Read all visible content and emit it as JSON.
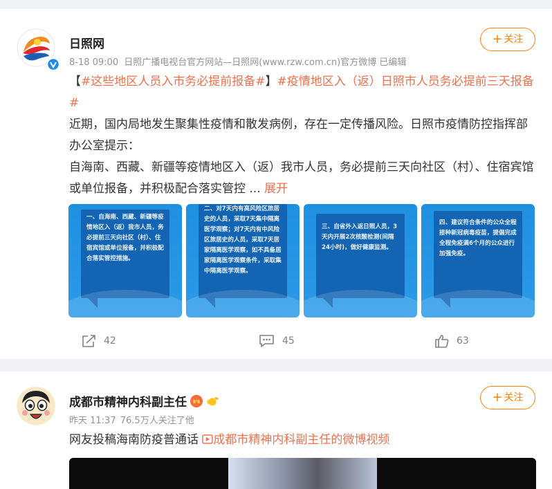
{
  "colors": {
    "accent": "#ff8200",
    "tag": "#eb7350",
    "tile_bg": "#1f8fe0",
    "tile_box": "#1464b4"
  },
  "post1": {
    "author": "日照网",
    "time": "8-18 09:00",
    "source": "日照广播电视台官方网站—日照网(www.rzw.com.cn)官方微博 已编辑",
    "follow_label": "关注",
    "tag_open": "【",
    "tag1": "#这些地区人员入市务必提前报备#",
    "tag_close": "】",
    "tag2": "#疫情地区入（返）日照市人员务必提前三天报备#",
    "para1": "近期，国内局地发生聚集性疫情和散发病例，存在一定传播风险。日照市疫情防控指挥部办公室提示：",
    "para2": "自海南、西藏、新疆等疫情地区入（返）我市人员，务必提前三天向社区（村）、住宿宾馆或单位报备，并积极配合落实管控",
    "ellipsis": " ...",
    "expand": "展开",
    "images": [
      {
        "text": "一、自海南、西藏、新疆等疫情地区入（返）我市人员，务必提前三天向社区（村）、住宿宾馆或单位报备，并积极配合落实管控措施。"
      },
      {
        "text": "二、对7天内有高风险区旅居史的人员，采取7天集中隔离医学观察；对7天内有中风险区旅居史的人员，采取7天居家隔离医学观察，如不具备居家隔离医学观察条件，采取集中隔离医学观察。"
      },
      {
        "text": "三、自省外入返日照人员，3天内开展2次核酸检测(间隔24小时)，做好健康监测。"
      },
      {
        "text": "四、建议符合条件的公众全程接种新冠病毒疫苗，提倡完成全程免疫满6个月的公众进行加强免疫。"
      }
    ],
    "repost_count": "42",
    "comment_count": "45",
    "like_count": "63"
  },
  "post2": {
    "author": "成都市精神内科副主任",
    "time": "昨天 11:37",
    "followers": "76.5万人关注了他",
    "follow_label": "关注",
    "text": "网友投稿海南防疫普通话",
    "video_link": "成都市精神内科副主任的微博视频"
  }
}
